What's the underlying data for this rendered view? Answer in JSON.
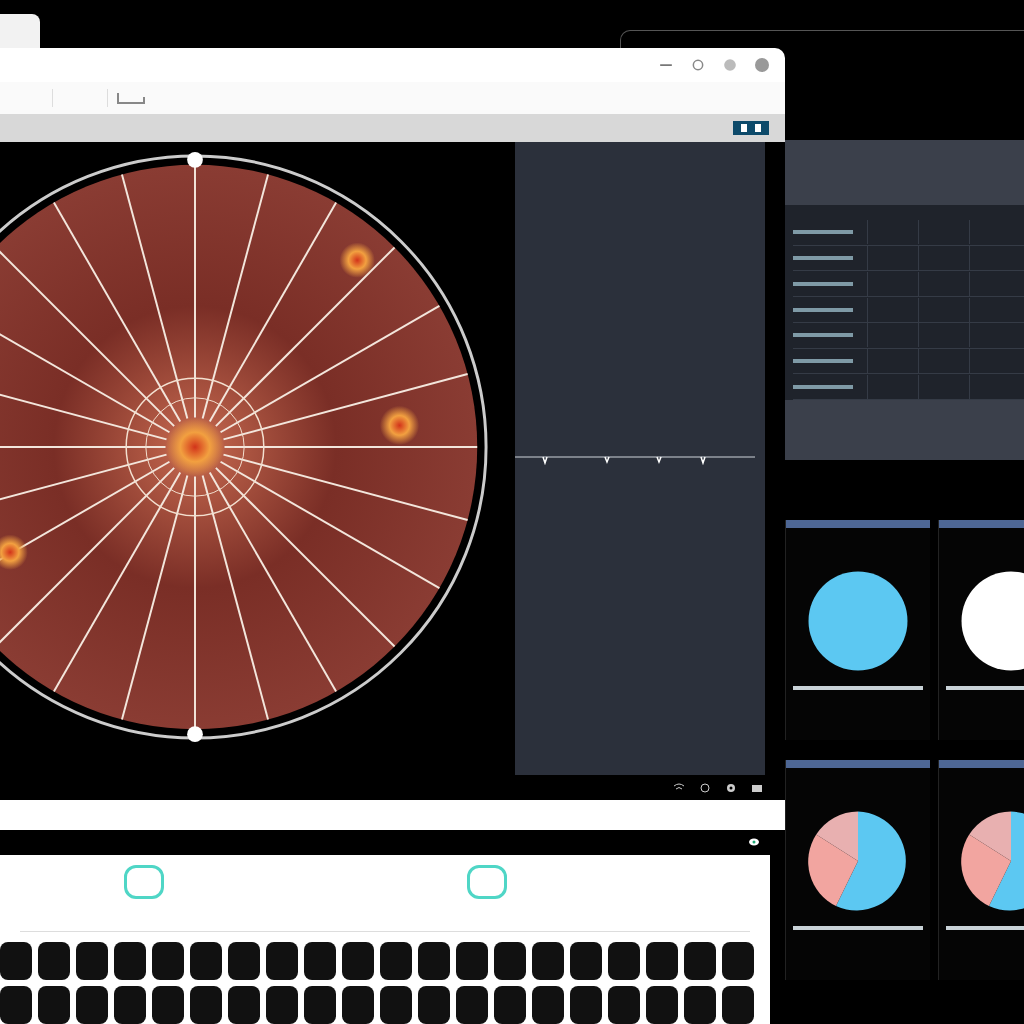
{
  "range_slider": {
    "handles": [
      {
        "level": 0.17
      },
      {
        "level": 0.64
      }
    ]
  },
  "pie_cards": [
    {
      "kind": "solid",
      "color": "#5cc8f2"
    },
    {
      "kind": "solid",
      "color": "#ffffff"
    },
    {
      "kind": "split",
      "color": "#5cc8f2"
    },
    {
      "kind": "split",
      "color": "#5cc8f2"
    }
  ]
}
